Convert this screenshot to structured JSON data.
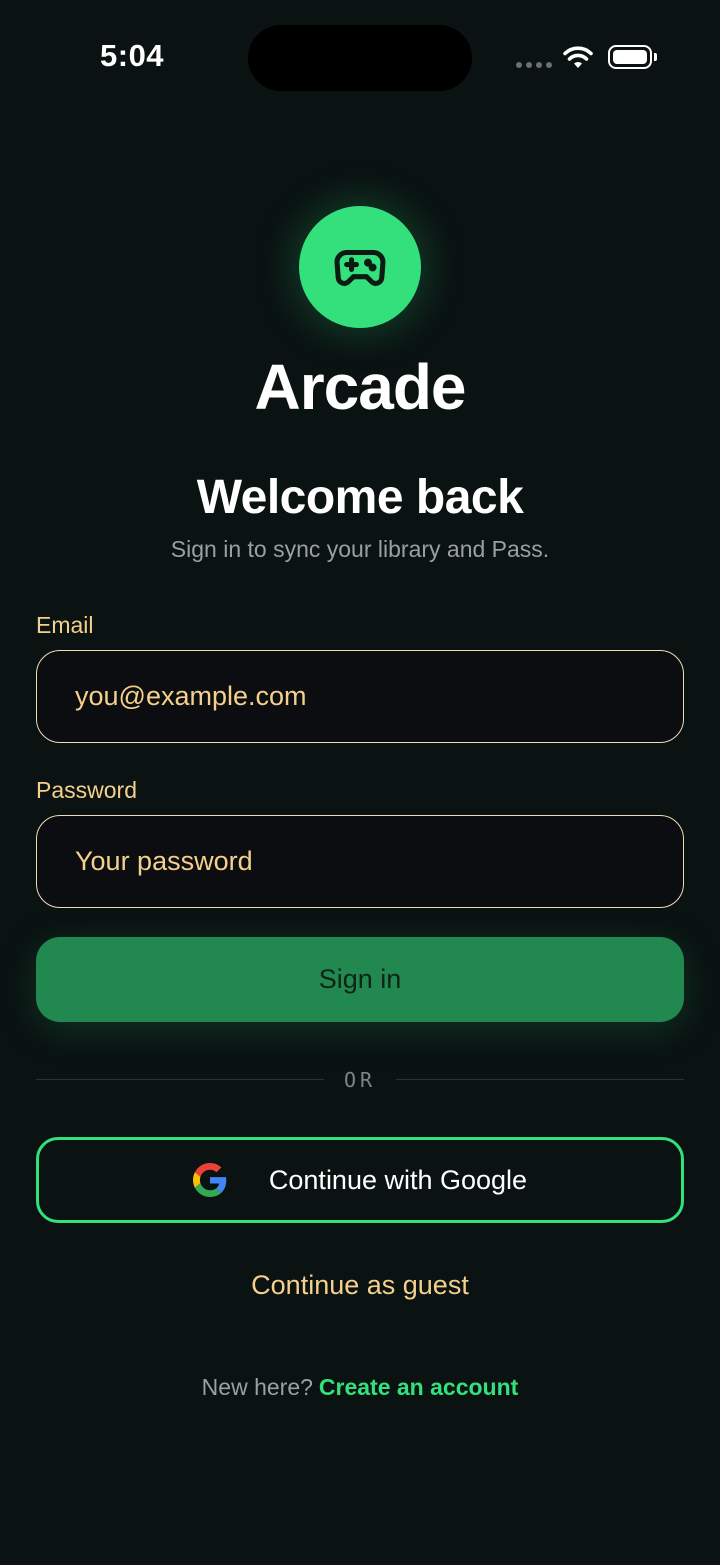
{
  "status_bar": {
    "time": "5:04"
  },
  "branding": {
    "logo_icon": "gamepad-icon",
    "app_name": "Arcade",
    "accent_color": "#33e07c"
  },
  "welcome": {
    "heading": "Welcome back",
    "subtitle": "Sign in to sync your library and Pass."
  },
  "form": {
    "email": {
      "label": "Email",
      "placeholder": "you@example.com",
      "value": ""
    },
    "password": {
      "label": "Password",
      "placeholder": "Your password",
      "value": ""
    },
    "signin_label": "Sign in"
  },
  "divider": {
    "label": "OR"
  },
  "social": {
    "google_icon": "google-icon",
    "google_label": "Continue with Google"
  },
  "guest": {
    "label": "Continue as guest"
  },
  "footer": {
    "prompt": "New here?",
    "link_label": "Create an account"
  }
}
